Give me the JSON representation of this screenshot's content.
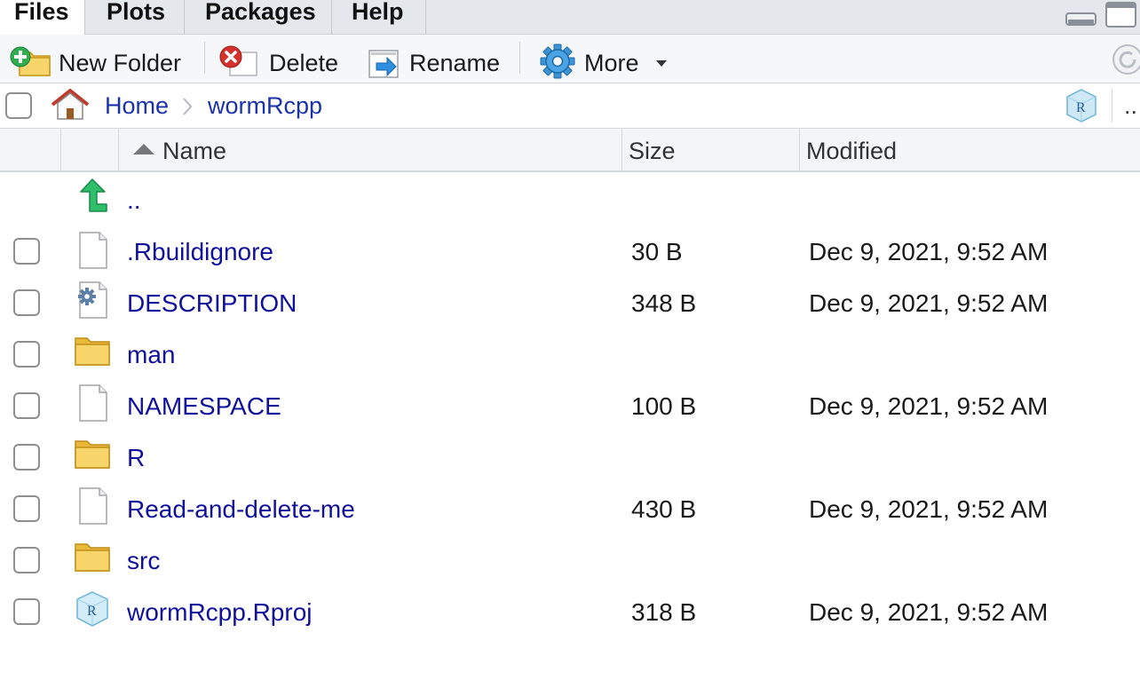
{
  "tabs": [
    {
      "label": "Files",
      "active": true
    },
    {
      "label": "Plots",
      "active": false
    },
    {
      "label": "Packages",
      "active": false
    },
    {
      "label": "Help",
      "active": false
    }
  ],
  "toolbar": {
    "new_folder": "New Folder",
    "delete": "Delete",
    "rename": "Rename",
    "more": "More"
  },
  "path": {
    "home": "Home",
    "separator": ">",
    "current": "wormRcpp",
    "overflow": ".."
  },
  "columns": {
    "name": "Name",
    "size": "Size",
    "modified": "Modified"
  },
  "parent_dir": "..",
  "files": [
    {
      "name": ".Rbuildignore",
      "size": "30 B",
      "modified": "Dec 9, 2021, 9:52 AM",
      "icon": "text-file-icon"
    },
    {
      "name": "DESCRIPTION",
      "size": "348 B",
      "modified": "Dec 9, 2021, 9:52 AM",
      "icon": "description-file-icon"
    },
    {
      "name": "man",
      "size": "",
      "modified": "",
      "icon": "folder-icon"
    },
    {
      "name": "NAMESPACE",
      "size": "100 B",
      "modified": "Dec 9, 2021, 9:52 AM",
      "icon": "text-file-icon"
    },
    {
      "name": "R",
      "size": "",
      "modified": "",
      "icon": "folder-icon"
    },
    {
      "name": "Read-and-delete-me",
      "size": "430 B",
      "modified": "Dec 9, 2021, 9:52 AM",
      "icon": "text-file-icon"
    },
    {
      "name": "src",
      "size": "",
      "modified": "",
      "icon": "folder-icon"
    },
    {
      "name": "wormRcpp.Rproj",
      "size": "318 B",
      "modified": "Dec 9, 2021, 9:52 AM",
      "icon": "rproj-file-icon"
    }
  ],
  "colors": {
    "link": "#10109c",
    "crumb": "#1b32a8",
    "tabbar_bg": "#e4e8ec",
    "header_bg": "#f4f5f6"
  }
}
